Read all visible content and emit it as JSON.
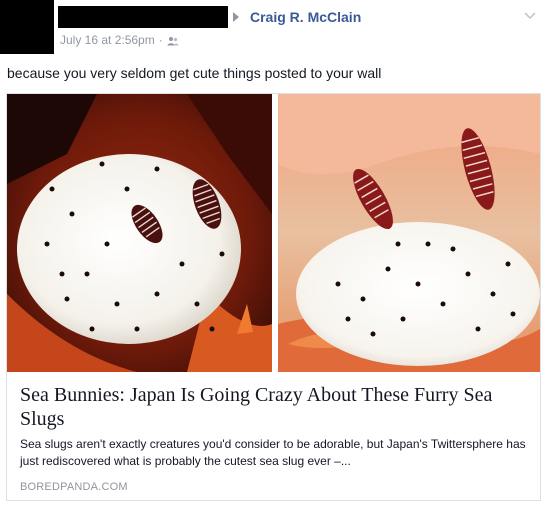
{
  "header": {
    "author_name": "Craig R. McClain",
    "timestamp": "July 16 at 2:56pm",
    "separator": "·",
    "audience_icon": "friends-icon",
    "menu_icon": "chevron-down-icon"
  },
  "post": {
    "text": "because you very seldom get cute things posted to your wall"
  },
  "link_card": {
    "images": [
      "sea-bunny-photo-left",
      "sea-bunny-photo-right"
    ],
    "title": "Sea Bunnies: Japan Is Going Crazy About These Furry Sea Slugs",
    "description": "Sea slugs aren't exactly creatures you'd consider to be adorable, but Japan's Twittersphere has just rediscovered what is probably the cutest sea slug ever –...",
    "domain": "BOREDPANDA.COM"
  },
  "colors": {
    "link_blue": "#3b5998",
    "meta_gray": "#9197a3",
    "text": "#141823"
  }
}
